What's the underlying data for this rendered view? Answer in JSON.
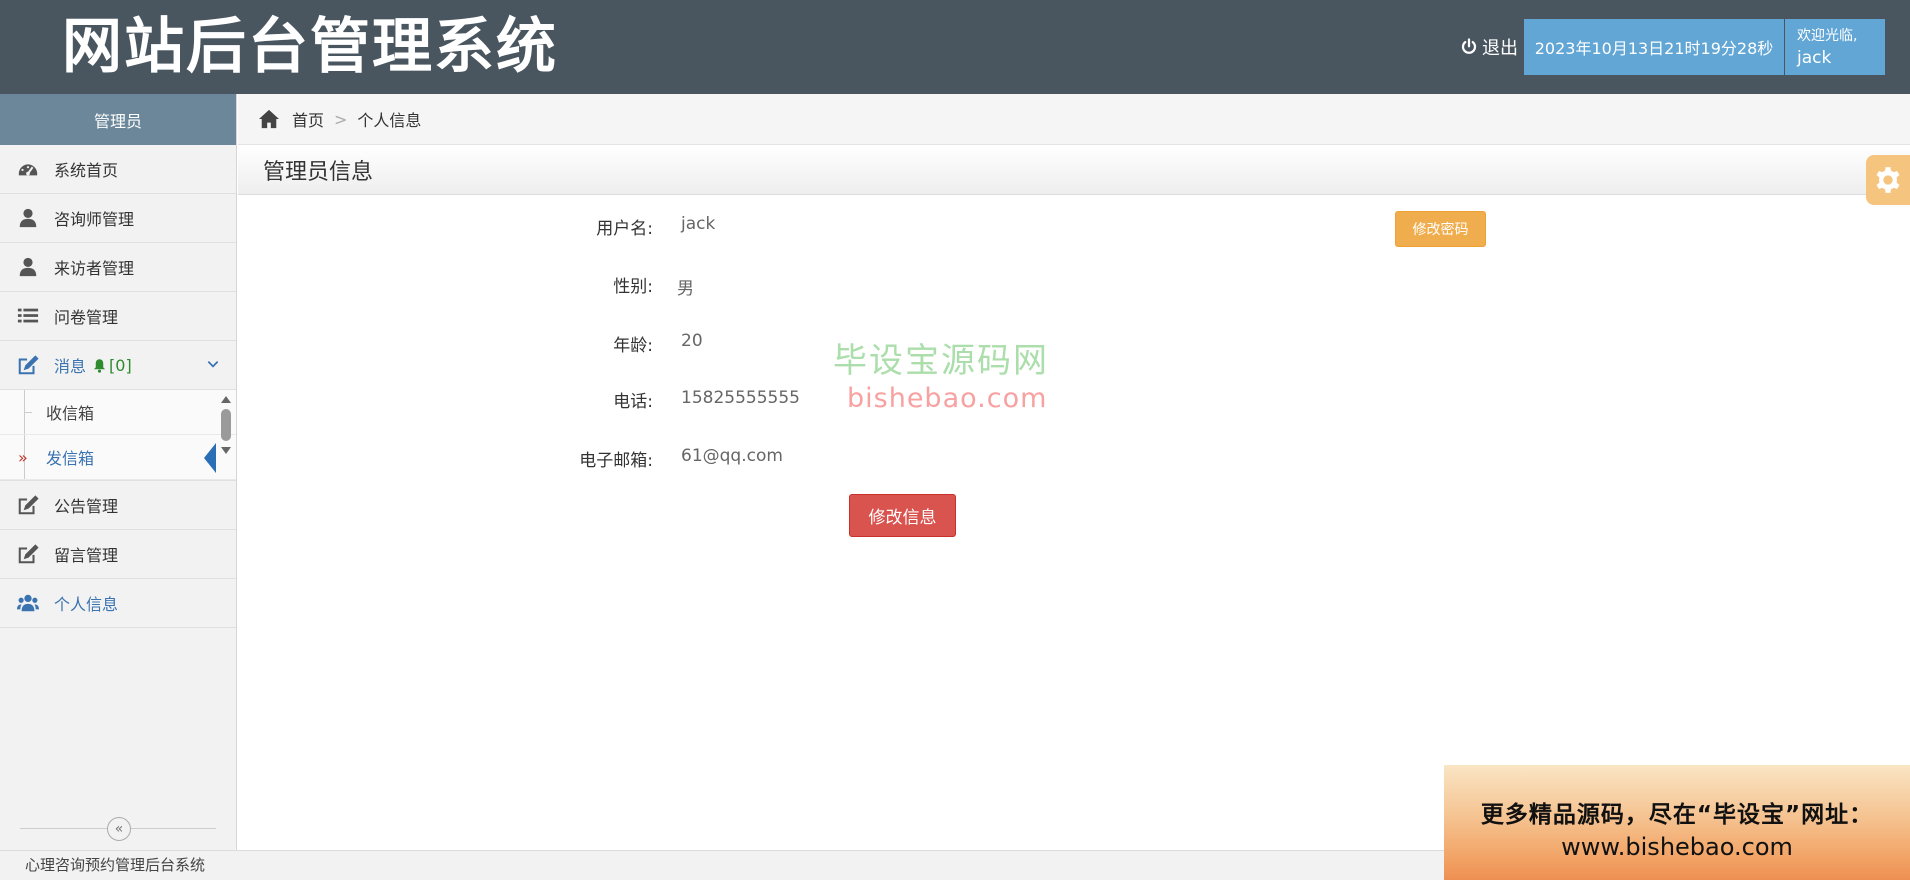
{
  "header": {
    "title": "网站后台管理系统",
    "logout_label": "退出",
    "datetime": "2023年10月13日21时19分28秒",
    "welcome": "欢迎光临,",
    "username": "jack"
  },
  "sidebar": {
    "role": "管理员",
    "items": [
      {
        "label": "系统首页",
        "icon": "dashboard-icon"
      },
      {
        "label": "咨询师管理",
        "icon": "user-icon"
      },
      {
        "label": "来访者管理",
        "icon": "user-icon"
      },
      {
        "label": "问卷管理",
        "icon": "list-icon"
      },
      {
        "label": "消息",
        "icon": "edit-icon",
        "badge": "[0]",
        "expanded": true
      },
      {
        "label": "公告管理",
        "icon": "edit-icon"
      },
      {
        "label": "留言管理",
        "icon": "edit-icon"
      },
      {
        "label": "个人信息",
        "icon": "users-icon",
        "active": true
      }
    ],
    "message_sub": [
      {
        "label": "收信箱"
      },
      {
        "label": "发信箱",
        "active": true
      }
    ]
  },
  "breadcrumb": {
    "home": "首页",
    "current": "个人信息"
  },
  "section": {
    "title": "管理员信息"
  },
  "profile": {
    "fields": [
      {
        "label": "用户名:",
        "value": "jack"
      },
      {
        "label": "性别:",
        "value": "男"
      },
      {
        "label": "年龄:",
        "value": "20"
      },
      {
        "label": "电话:",
        "value": "15825555555"
      },
      {
        "label": "电子邮箱:",
        "value": "61@qq.com"
      }
    ],
    "change_password_label": "修改密码",
    "edit_label": "修改信息"
  },
  "watermark": {
    "cn": "毕设宝源码网",
    "en": "bishebao.com"
  },
  "footer": {
    "text": "心理咨询预约管理后台系统"
  },
  "promo": {
    "line1": "更多精品源码，尽在“毕设宝”网址：",
    "line2": "www.bishebao.com"
  },
  "colors": {
    "header_bg": "#4a565f",
    "sidebar_head_bg": "#6b8799",
    "accent_blue": "#62a6d6",
    "link_blue": "#3a73b0",
    "warning": "#f0ad4e",
    "danger": "#d9534f"
  }
}
